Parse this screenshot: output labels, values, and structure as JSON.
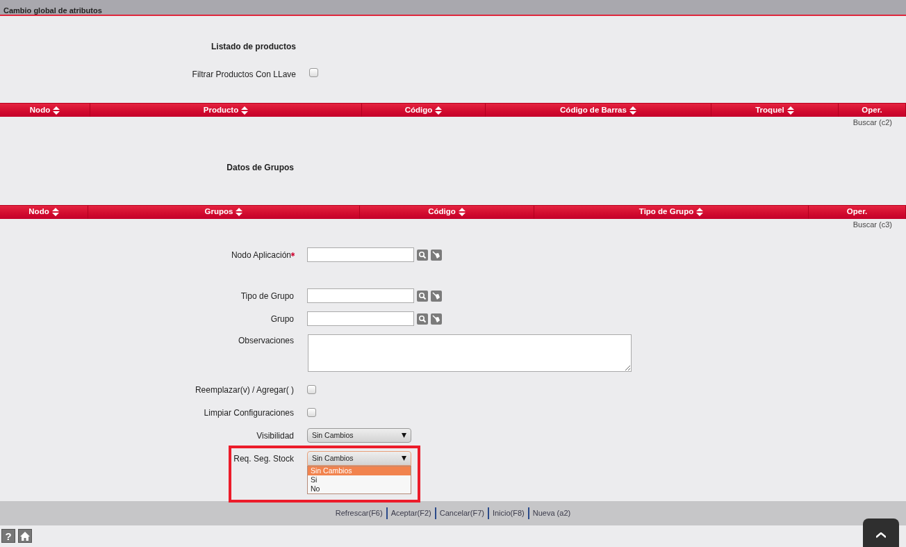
{
  "title": "Cambio global de atributos",
  "sections": [
    {
      "heading": "Listado de productos",
      "filter": {
        "label": "Filtrar Productos Con LLave",
        "checked": false
      },
      "columns": [
        {
          "label": "Nodo",
          "sortable": true
        },
        {
          "label": "Producto",
          "sortable": true
        },
        {
          "label": "Código",
          "sortable": true
        },
        {
          "label": "Código de Barras",
          "sortable": true
        },
        {
          "label": "Troquel",
          "sortable": true
        },
        {
          "label": "Oper.",
          "sortable": false
        }
      ],
      "search_link": "Buscar (c2)"
    },
    {
      "heading": "Datos de Grupos",
      "columns": [
        {
          "label": "Nodo",
          "sortable": true
        },
        {
          "label": "Grupos",
          "sortable": true
        },
        {
          "label": "Código",
          "sortable": true
        },
        {
          "label": "Tipo de Grupo",
          "sortable": true
        },
        {
          "label": "Oper.",
          "sortable": false
        }
      ],
      "search_link": "Buscar (c3)"
    }
  ],
  "form": [
    {
      "kind": "lookup",
      "label": "Nodo Aplicación",
      "required": true
    },
    {
      "kind": "lookup",
      "label": "Tipo de Grupo",
      "required": false
    },
    {
      "kind": "lookup",
      "label": "Grupo",
      "required": false
    },
    {
      "kind": "textarea",
      "label": "Observaciones"
    },
    {
      "kind": "checkbox",
      "label": "Reemplazar(v) / Agregar( )",
      "checked": false
    },
    {
      "kind": "checkbox",
      "label": "Limpiar Configuraciones",
      "checked": false
    },
    {
      "kind": "select",
      "label": "Visibilidad",
      "value": "Sin Cambios",
      "expanded": false,
      "highlighted": false
    },
    {
      "kind": "select",
      "label": "Req. Seg. Stock",
      "value": "Sin Cambios",
      "expanded": true,
      "highlighted": true,
      "options": [
        {
          "label": "Sin Cambios",
          "selected": true
        },
        {
          "label": "Si",
          "selected": false
        },
        {
          "label": "No",
          "selected": false
        }
      ]
    }
  ],
  "actions": [
    "Refrescar(F6)",
    "Aceptar(F2)",
    "Cancelar(F7)",
    "Inicio(F8)",
    "Nueva (a2)"
  ],
  "help_button": "?"
}
